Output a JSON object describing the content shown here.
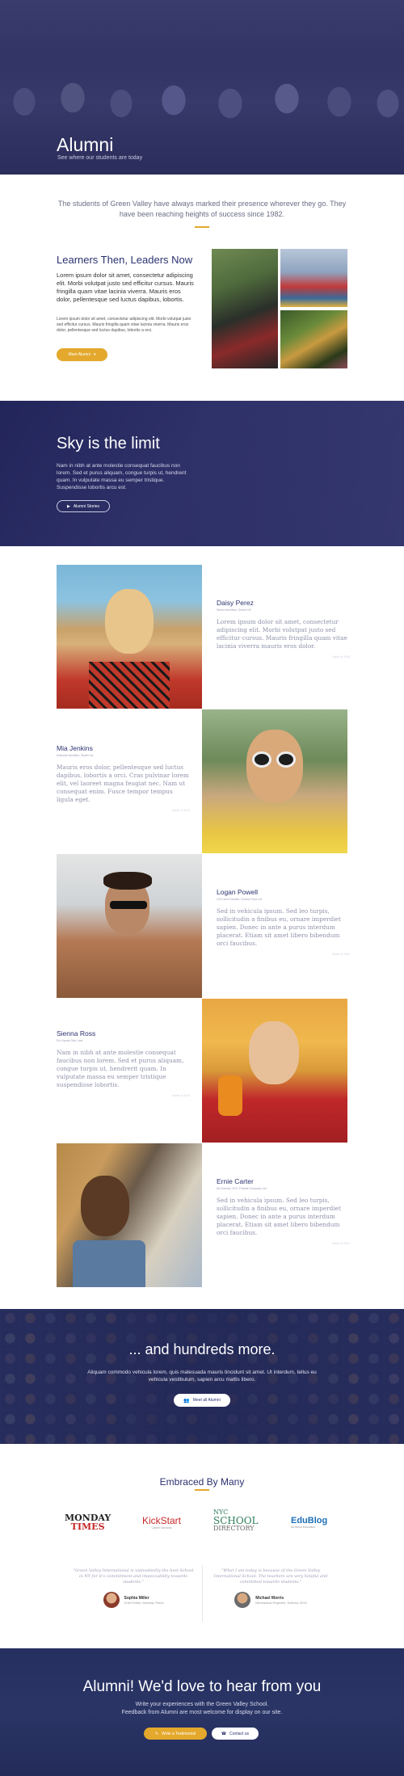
{
  "hero": {
    "title": "Alumni",
    "subtitle": "See where our students are today"
  },
  "intro": {
    "text": "The students of Green Valley have always marked their presence wherever they go. They have been reaching heights of success since 1982."
  },
  "leaders": {
    "title": "Learners Then, Leaders Now",
    "p1": "Lorem ipsum dolor sit amet, consectetur adipiscing elit. Morbi volutpat justo sed efficitur cursus. Mauris fringilla quam vitae lacinia viverra. Mauris eros dolor, pellentesque sed luctus dapibus, lobortis.",
    "p2": "Lorem ipsum dolor sit amet, consectetur adipiscing elit. Morbi volutpat justo sed efficitur cursus. Mauris fringilla quam vitae lacinia viverra. Mauris eros dolor, pellentesque sed luctus dapibus, lobortis a orci.",
    "button": "Meet Alumni"
  },
  "sky": {
    "title": "Sky is the limit",
    "text": "Nam in nibh at ante molestie consequat faucibus non lorem. Sed et purus aliquam, congue turpis ut, hendrerit quam. In vulputate massa eu semper tristique. Suspendisse lobortis arcu est.",
    "button": "Alumni Stories"
  },
  "people": [
    {
      "name": "Daisy Perez",
      "title": "Senior Architect, Oxford US",
      "quote": "Lorem ipsum dolor sit amet, consectetur adipiscing elit. Morbi volutpat justo sed efficitur cursus. Mauris fringilla quam vitae lacinia viverra mauris eros dolor.",
      "date": "Batch of 2008"
    },
    {
      "name": "Mia Jenkins",
      "title": "Software Architect, Studio Inc",
      "quote": "Mauris eros dolor, pellentesque sed luctus dapibus, lobortis a orci. Cras pulvinar lorem elit, vel laoreet magna feugiat nec. Nam ut consequat enim. Fusce tempor tempus ligula eget.",
      "date": "Batch of 2012"
    },
    {
      "name": "Logan Powell",
      "title": "CEO and Founder, Gordon Tops Ltd",
      "quote": "Sed in vehicula ipsum. Sed leo turpis, sollicitudin a finibus eu, ornare imperdiet sapien. Donec in ante a purus interdum placerat. Etiam sit amet libero bibendum orci faucibus.",
      "date": "Batch of 2002"
    },
    {
      "name": "Sienna Ross",
      "title": "Pro Sports Star, Lets",
      "quote": "Nam in nibh at ante molestie consequat faucibus non lorem. Sed et purus aliquam, congue turpis ut, hendrerit quam. In vulputate massa eu semper tristique suspendisse lobortis.",
      "date": "Batch of 2010"
    },
    {
      "name": "Ernie Carter",
      "title": "Art Director, NYC Theatre Company Ltd",
      "quote": "Sed in vehicula ipsum. Sed leo turpis, sollicitudin a finibus eu, ornare imperdiet sapien. Donec in ante a purus interdum placerat. Etiam sit amet libero bibendum orci faucibus.",
      "date": "Batch of 2001"
    }
  ],
  "more": {
    "title": "... and hundreds more.",
    "text": "Aliquam commodo vehicula lorem, quis malesuada mauris tincidunt sit amet. Ut interdum, tellus eu vehicula vestibulum, sapien arcu mattis libero.",
    "button": "Meet all Alumni"
  },
  "embraced": {
    "title": "Embraced By Many",
    "logos": [
      {
        "a": "MONDAY",
        "b": "TIMES"
      },
      {
        "a": "KickStart",
        "b": "Career Services"
      },
      {
        "a": "NYC",
        "b": "SCHOOL",
        "c": "DIRECTORY"
      },
      {
        "a": "EduBlog",
        "b": "All About Education"
      }
    ],
    "testimonials": [
      {
        "quote": "\"Green Valley International is undoubtedly the best School in NY for it's commitment and impeccability towards students.\"",
        "name": "Sophia Miller",
        "role": "Chief Editor, Monday Times"
      },
      {
        "quote": "\"What I am today is because of the Green Valley International School. The teachers are very helpful and committed towards students.\"",
        "name": "Michael Morris",
        "role": "Mechanical Engineer, Science 2013"
      }
    ]
  },
  "footer": {
    "title": "Alumni! We'd love to hear from you",
    "line1": "Write your experiences with the Green Valley School.",
    "line2": "Feedback from Alumni are most welcome for display on our site.",
    "btn1": "Write a Testimonial",
    "btn2": "Contact us"
  },
  "colors": {
    "navy": "#2b3270",
    "gold": "#e3a82c"
  }
}
